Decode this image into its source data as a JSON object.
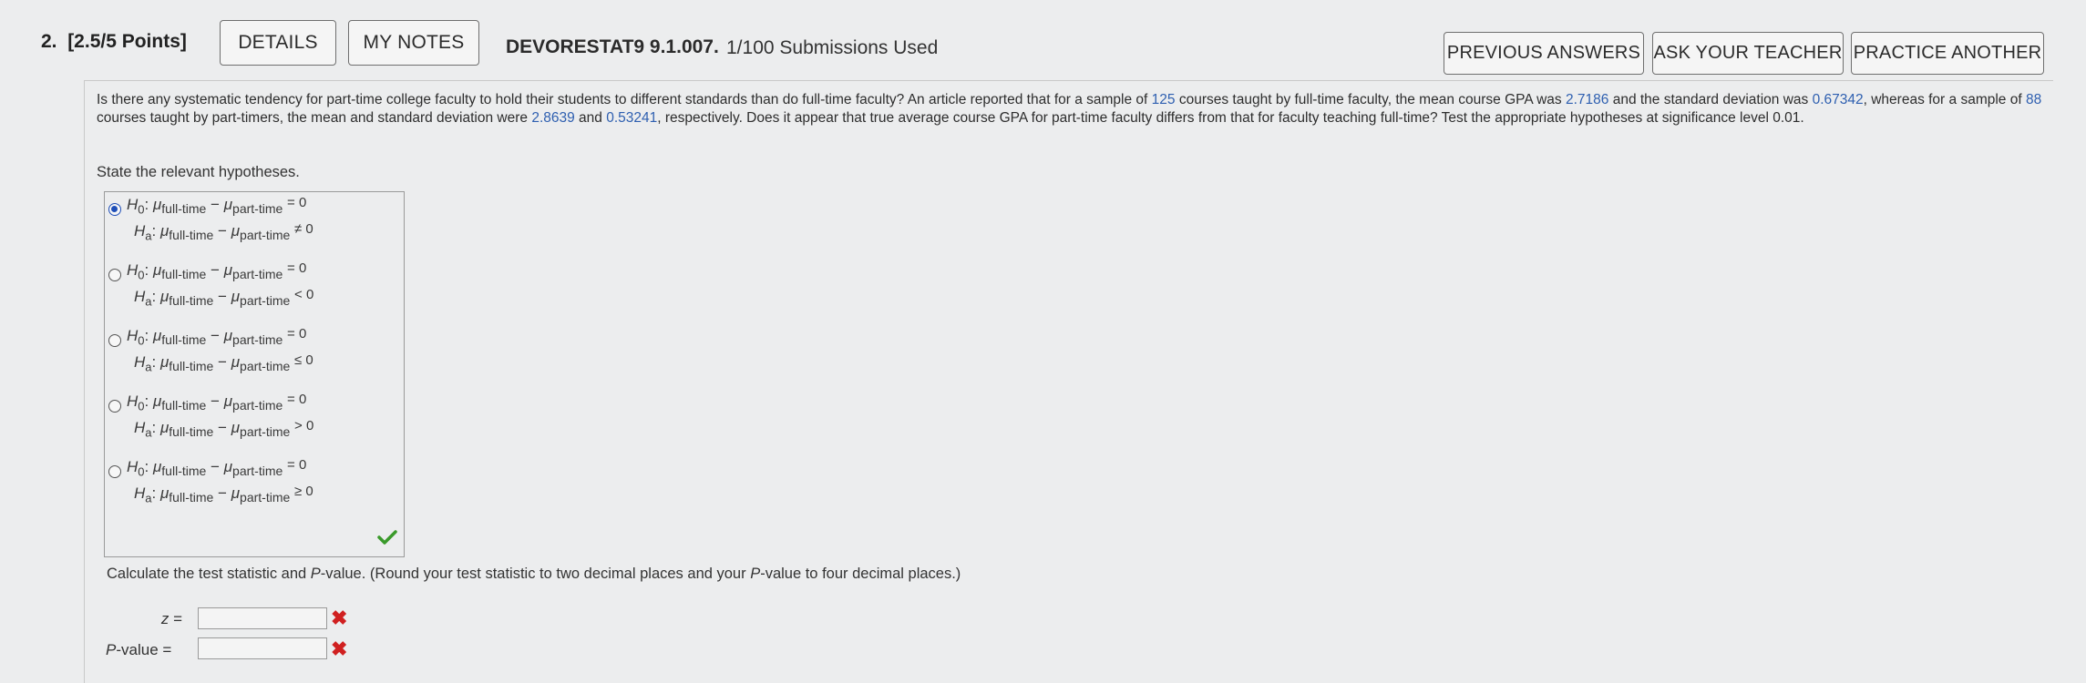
{
  "header": {
    "question_number": "2.",
    "points": "[2.5/5 Points]",
    "details_label": "DETAILS",
    "my_notes_label": "MY NOTES",
    "problem_id": "DEVORESTAT9 9.1.007.",
    "submissions": "1/100 Submissions Used",
    "previous_answers_label": "PREVIOUS ANSWERS",
    "ask_teacher_label": "ASK YOUR TEACHER",
    "practice_another_label": "PRACTICE ANOTHER"
  },
  "question": {
    "p1": "Is there any systematic tendency for part-time college faculty to hold their students to different standards than do full-time faculty? An article reported that for a sample of ",
    "n_full": "125",
    "p2": " courses taught by full-time faculty, the mean course GPA was ",
    "mean_full": "2.7186",
    "p3": " and the standard deviation was ",
    "sd_full": "0.67342",
    "p4": ", whereas for a sample of ",
    "n_part": "88",
    "p5": " courses taught by part-timers, the mean and standard deviation were ",
    "mean_part": "2.8639",
    "p6": " and ",
    "sd_part": "0.53241",
    "p7": ", respectively. Does it appear that true average course GPA for part-time faculty differs from that for faculty teaching full-time? Test the appropriate hypotheses at significance level ",
    "alpha": "0.01",
    "p8": "."
  },
  "hypotheses": {
    "prompt": "State the relevant hypotheses.",
    "h0": "H",
    "h0_sub": "0",
    "ha": "H",
    "ha_sub": "a",
    "mu": "μ",
    "full": "full-time",
    "part": "part-time",
    "minus": "−",
    "options": [
      {
        "h0_rel": "= 0",
        "ha_rel": "≠ 0",
        "selected": true
      },
      {
        "h0_rel": "= 0",
        "ha_rel": "< 0",
        "selected": false
      },
      {
        "h0_rel": "= 0",
        "ha_rel": "≤ 0",
        "selected": false
      },
      {
        "h0_rel": "= 0",
        "ha_rel": "> 0",
        "selected": false
      },
      {
        "h0_rel": "= 0",
        "ha_rel": "≥ 0",
        "selected": false
      }
    ],
    "status": "correct"
  },
  "calculate": {
    "prompt_a": "Calculate the test statistic and ",
    "p_italic": "P",
    "prompt_b": "-value. (Round your test statistic to two decimal places and your ",
    "p_italic2": "P",
    "prompt_c": "-value to four decimal places.)",
    "z_label": "z",
    "pvalue_label": "-value",
    "equals": "=",
    "z_value": "",
    "p_value": "",
    "z_status": "incorrect",
    "p_status": "incorrect"
  },
  "colors": {
    "accent": "#1f4fb8",
    "number_blue": "#2e5fb0",
    "wrong": "#d02020",
    "right": "#3a9a2a"
  }
}
